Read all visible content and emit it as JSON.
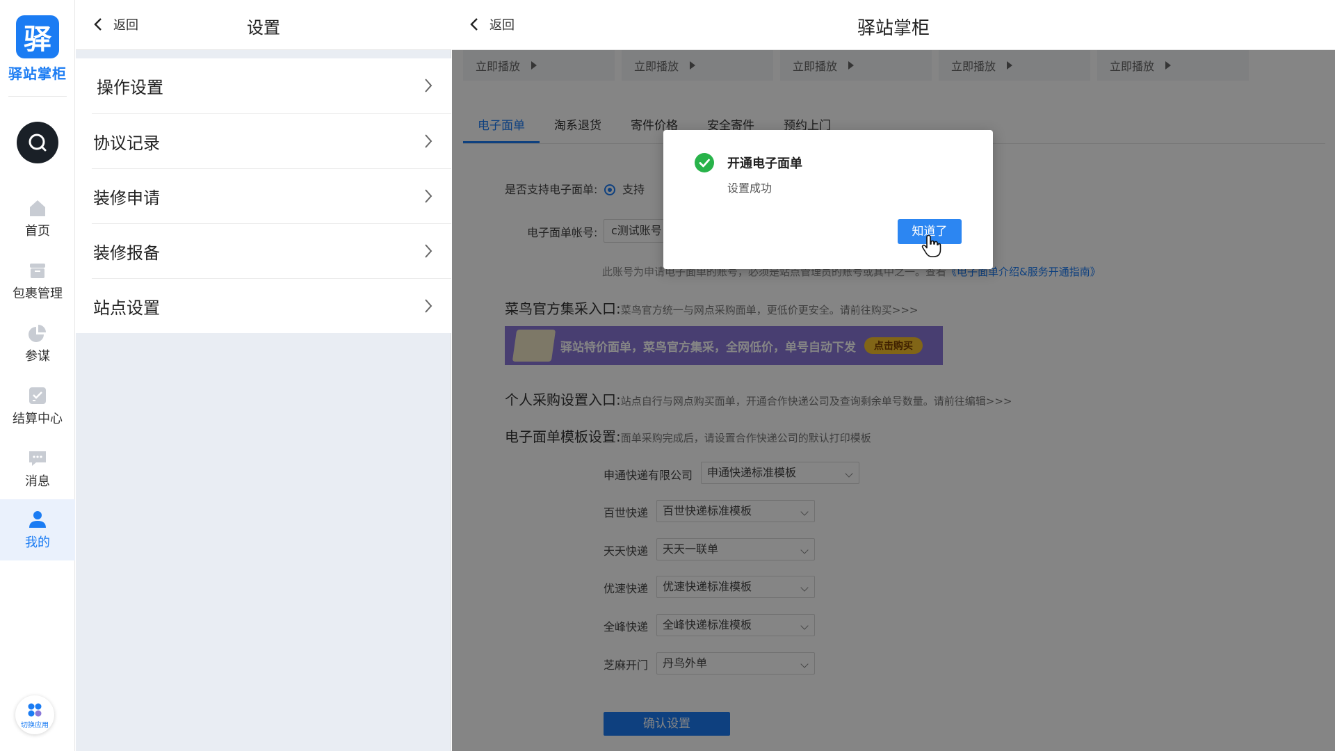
{
  "nav": {
    "logo_char": "驿",
    "logo_text": "驿站掌柜",
    "items": [
      {
        "label": "首页",
        "icon": "home-icon"
      },
      {
        "label": "包裹管理",
        "icon": "package-icon"
      },
      {
        "label": "参谋",
        "icon": "pie-chart-icon"
      },
      {
        "label": "结算中心",
        "icon": "settlement-icon"
      },
      {
        "label": "消息",
        "icon": "message-icon"
      },
      {
        "label": "我的",
        "icon": "user-icon",
        "active": true
      }
    ],
    "switch_app": "切换应用"
  },
  "settings": {
    "back": "返回",
    "title": "设置",
    "items": [
      "操作设置",
      "协议记录",
      "装修申请",
      "装修报备",
      "站点设置"
    ]
  },
  "main": {
    "back": "返回",
    "title": "驿站掌柜",
    "play_cards": [
      "立即播放",
      "立即播放",
      "立即播放",
      "立即播放",
      "立即播放"
    ],
    "tabs": [
      "电子面单",
      "淘系退货",
      "寄件价格",
      "安全寄件",
      "预约上门"
    ],
    "support_label": "是否支持电子面单:",
    "support_option": "支持",
    "account_label": "电子面单帐号:",
    "account_value": "c测试账号",
    "account_hint": "此账号为申请电子面单的账号，必须是站点管理员的账号或其中之一。查看",
    "account_hint_link": "《电子面单介绍&服务开通指南》",
    "cainiao_title": "菜鸟官方集采入口:",
    "cainiao_desc": "菜鸟官方统一与网点采购面单，更低价更安全。",
    "cainiao_link": "请前往购买>>>",
    "banner_text": "驿站特价面单，菜鸟官方集采，全网低价，单号自动下发",
    "banner_button": "点击购买",
    "personal_title": "个人采购设置入口:",
    "personal_desc": "站点自行与网点购买面单，开通合作快递公司及查询剩余单号数量。",
    "personal_link": "请前往编辑>>>",
    "template_title": "电子面单模板设置:",
    "template_desc": "面单采购完成后，请设置合作快递公司的默认打印模板",
    "templates": [
      {
        "company": "申通快递有限公司",
        "template": "申通快递标准模板"
      },
      {
        "company": "百世快递",
        "template": "百世快递标准模板"
      },
      {
        "company": "天天快递",
        "template": "天天一联单"
      },
      {
        "company": "优速快递",
        "template": "优速快递标准模板"
      },
      {
        "company": "全峰快递",
        "template": "全峰快递标准模板"
      },
      {
        "company": "芝麻开门",
        "template": "丹鸟外单"
      }
    ],
    "confirm": "确认设置"
  },
  "modal": {
    "title": "开通电子面单",
    "message": "设置成功",
    "button": "知道了"
  },
  "colors": {
    "brand": "#1b7cf3",
    "success": "#28b34a",
    "banner": "#8a78d8"
  }
}
